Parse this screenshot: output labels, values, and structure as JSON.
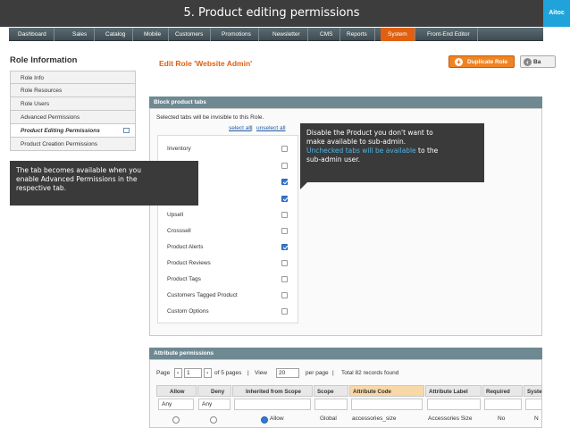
{
  "slide": {
    "title": "5. Product editing permissions",
    "brand": "Aitoc"
  },
  "nav": {
    "items": [
      "Dashboard",
      "Sales",
      "Catalog",
      "Mobile",
      "Customers",
      "Promotions",
      "Newsletter",
      "CMS",
      "Reports",
      "System",
      "Front-End Editor"
    ],
    "active": "System"
  },
  "sidebar": {
    "title": "Role Information",
    "tabs": [
      "Role Info",
      "Role Resources",
      "Role Users",
      "Advanced Permissions",
      "Product Editing Permissions",
      "Product Creation Permissions"
    ],
    "active_tab": "Product Editing Permissions"
  },
  "content": {
    "title": "Edit Role 'Website Admin'",
    "duplicate_button": "Duplicate Role",
    "back_button": "Ba"
  },
  "block_tabs": {
    "header": "Block product tabs",
    "note": "Selected tabs will be invisible to this Role.",
    "select_all": "select all",
    "separator": "|",
    "unselect_all": "unselect all",
    "items": [
      {
        "label": "Inventory",
        "checked": false
      },
      {
        "label": "",
        "checked": false
      },
      {
        "label": "",
        "checked": true
      },
      {
        "label": "",
        "checked": true
      },
      {
        "label": "Upsell",
        "checked": false
      },
      {
        "label": "Crosssell",
        "checked": false
      },
      {
        "label": "Product Alerts",
        "checked": true
      },
      {
        "label": "Product Reviews",
        "checked": false
      },
      {
        "label": "Product Tags",
        "checked": false
      },
      {
        "label": "Customers Tagged Product",
        "checked": false
      },
      {
        "label": "Custom Options",
        "checked": false
      }
    ]
  },
  "callouts": {
    "right": {
      "line1": "Disable the Product you don't want to",
      "line2": "make available to sub-admin.",
      "line3_highlight": "Unchecked tabs will be available",
      "line3_rest": " to the",
      "line4": "sub-admin user."
    },
    "left": {
      "line1": "The tab becomes available when you",
      "line2": "enable Advanced Permissions in the",
      "line3": "respective tab."
    }
  },
  "attributes": {
    "header": "Attribute permissions",
    "page_label": "Page",
    "page_value": "1",
    "of_pages": "of 5 pages",
    "view_label": "View",
    "view_value": "20",
    "per_page": "per page",
    "total": "Total 82 records found",
    "columns": [
      "Allow",
      "Deny",
      "Inherited from Scope",
      "Scope",
      "Attribute Code",
      "Attribute Label",
      "Required",
      "Syste"
    ],
    "filters": [
      "Any",
      "Any"
    ],
    "row": {
      "allow": "Allow",
      "scope": "Global",
      "code": "accessories_size",
      "label": "Accessories Size",
      "required": "No",
      "system": "N"
    }
  }
}
